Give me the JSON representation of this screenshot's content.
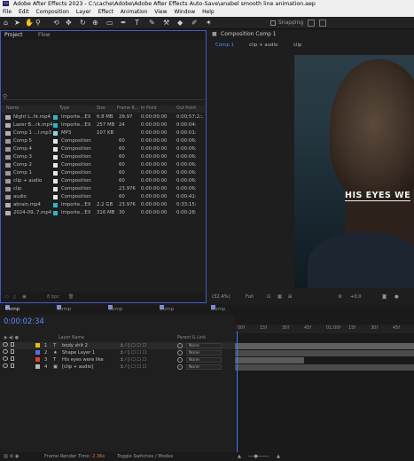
{
  "window": {
    "title": "Adobe After Effects 2023 - C:\\cache\\Adobe\\Adobe After Effects Auto-Save\\anabel smooth line animation.aep"
  },
  "menu": [
    "File",
    "Edit",
    "Composition",
    "Layer",
    "Effect",
    "Animation",
    "View",
    "Window",
    "Help"
  ],
  "toolbar": {
    "snapping_label": "Snapping"
  },
  "project": {
    "tabs": [
      "Project",
      "Flow"
    ],
    "columns": [
      "Name",
      "Type",
      "Size",
      "Frame R...",
      "In Point",
      "Out Point"
    ],
    "items": [
      {
        "name": "Night L..ht.mp4",
        "type": "Importe...EX",
        "size": "6.8 MB",
        "fps": "29.97",
        "in": "0;00;00;00",
        "out": "0;00;57;2",
        "label_color": "#2fb6c4"
      },
      {
        "name": "Lazer B...rk.mp4",
        "type": "Importe...EX",
        "size": "257 MB",
        "fps": "24",
        "in": "0:00:00:00",
        "out": "0:00:04:"
      },
      {
        "name": "Comp 1 ...l.mp3",
        "type": "MP3",
        "size": "107 KB",
        "fps": "",
        "in": "0:00:00:00",
        "out": "0:00:01:"
      },
      {
        "name": "Comp 5",
        "type": "Composition",
        "size": "",
        "fps": "60",
        "in": "0:00:00:00",
        "out": "0:00:06:"
      },
      {
        "name": "Comp 4",
        "type": "Composition",
        "size": "",
        "fps": "60",
        "in": "0:00:00:00",
        "out": "0:00:06:"
      },
      {
        "name": "Comp 3",
        "type": "Composition",
        "size": "",
        "fps": "60",
        "in": "0:00:00:00",
        "out": "0:00:06:"
      },
      {
        "name": "Comp 2",
        "type": "Composition",
        "size": "",
        "fps": "60",
        "in": "0:00:00:00",
        "out": "0:00:06:"
      },
      {
        "name": "Comp 1",
        "type": "Composition",
        "size": "",
        "fps": "60",
        "in": "0:00:00:00",
        "out": "0:00:06:"
      },
      {
        "name": "clip + audio",
        "type": "Composition",
        "size": "",
        "fps": "60",
        "in": "0:00:00:00",
        "out": "0:00:06:"
      },
      {
        "name": "clip",
        "type": "Composition",
        "size": "",
        "fps": "23.976",
        "in": "0:00:00:00",
        "out": "0:00:06:"
      },
      {
        "name": "audio",
        "type": "Composition",
        "size": "",
        "fps": "60",
        "in": "0:00:00:00",
        "out": "0:00:42:"
      },
      {
        "name": "abrain.mp4",
        "type": "Importe...EX",
        "size": "2.2 GB",
        "fps": "23.976",
        "in": "0:00:00:00",
        "out": "0:33:15:"
      },
      {
        "name": "2024-09..7.mp4",
        "type": "Importe...EX",
        "size": "316 MB",
        "fps": "30",
        "in": "0:00:00:00",
        "out": "0:00:28:"
      }
    ],
    "bpc": "8 bpc"
  },
  "composition": {
    "tab_label": "Composition Comp 1",
    "flow": [
      "Comp 1",
      "clip + audio",
      "clip"
    ],
    "caption": "HIS EYES WE",
    "zoom": "(32.4%)",
    "quality": "Full",
    "exposure": "+0.0"
  },
  "timeline": {
    "tabs": [
      "Comp 1",
      "Comp 2",
      "Comp 3",
      "Comp 4",
      "Comp 5"
    ],
    "timecode": "0:00:02:34",
    "ruler": [
      "00f",
      "15f",
      "30f",
      "45f",
      "01:00f",
      "15f",
      "30f",
      "45f"
    ],
    "layer_columns": [
      "Layer Name",
      "Parent & Link"
    ],
    "layers": [
      {
        "num": "1",
        "name": "body shit 2",
        "parent": "None",
        "icon": "T",
        "swatch": "#e4bd1a"
      },
      {
        "num": "2",
        "name": "Shape Layer 1",
        "parent": "None",
        "icon": "★",
        "swatch": "#5a6fd6"
      },
      {
        "num": "3",
        "name": "His eyes were like",
        "parent": "None",
        "icon": "T",
        "swatch": "#e23b3b"
      },
      {
        "num": "4",
        "name": "[clip + audio]",
        "parent": "None",
        "icon": "▣",
        "swatch": "#b9b9b9"
      }
    ]
  },
  "status": {
    "render_label": "Frame Render Time:",
    "render_value": "2.36s",
    "toggle": "Toggle Switches / Modes"
  }
}
